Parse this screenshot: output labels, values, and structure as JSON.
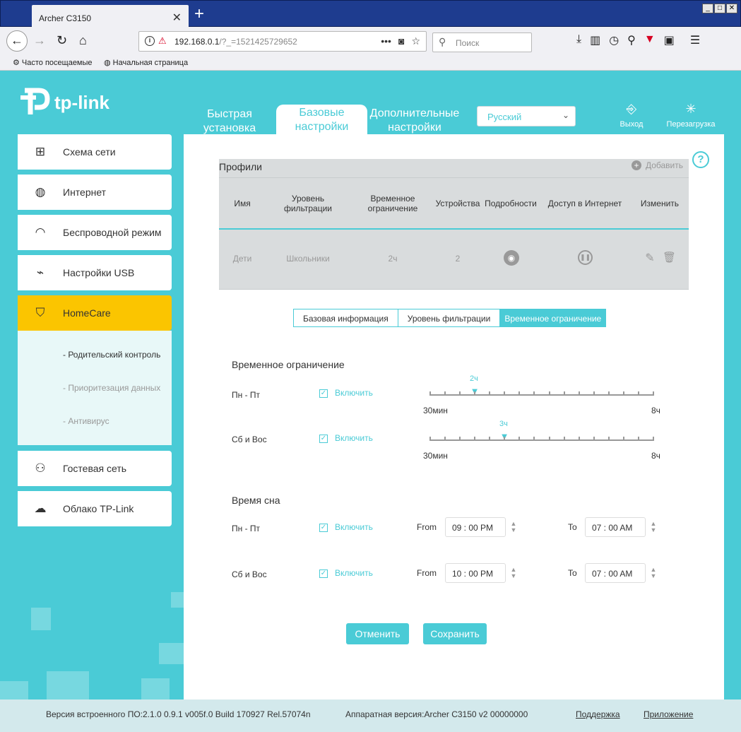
{
  "browser": {
    "tab_title": "Archer C3150",
    "url_host": "192.168.0.1",
    "url_rest": "/?_=1521425729652",
    "search_placeholder": "Поиск",
    "bookmarks": [
      "Часто посещаемые",
      "Начальная страница"
    ]
  },
  "brand": {
    "logo_text": "tp-link",
    "accent": "#4acbd6",
    "highlight": "#fbc500"
  },
  "topnav": {
    "quick": "Быстрая установка",
    "basic": "Базовые настройки",
    "advanced": "Дополнительные настройки",
    "language": "Русский",
    "logout": "Выход",
    "reboot": "Перезагрузка"
  },
  "sidebar": {
    "items": [
      {
        "label": "Схема сети",
        "icon": "network-map-icon"
      },
      {
        "label": "Интернет",
        "icon": "globe-icon"
      },
      {
        "label": "Беспроводной режим",
        "icon": "wifi-icon"
      },
      {
        "label": "Настройки USB",
        "icon": "usb-icon"
      },
      {
        "label": "HomeCare",
        "icon": "shield-icon"
      },
      {
        "label": "Гостевая сеть",
        "icon": "guests-icon"
      },
      {
        "label": "Облако TP-Link",
        "icon": "cloud-icon"
      }
    ],
    "sub_items": [
      "- Родительский контроль",
      "- Приоритезация данных",
      "- Антивирус"
    ]
  },
  "profiles": {
    "title": "Профили",
    "add_label": "Добавить",
    "headers": {
      "name": "Имя",
      "filter": "Уровень фильтрации",
      "time": "Временное ограничение",
      "devices": "Устройства",
      "details": "Подробности",
      "access": "Доступ в Интернет",
      "edit": "Изменить"
    },
    "row": {
      "name": "Дети",
      "filter": "Школьники",
      "time": "2ч",
      "devices": "2"
    }
  },
  "subtabs": [
    "Базовая информация",
    "Уровень фильтрации",
    "Временное ограничение"
  ],
  "time_limit": {
    "title": "Временное ограничение",
    "min_label": "30мин",
    "max_label": "8ч",
    "enable_label": "Включить",
    "weekdays": {
      "label": "Пн - Пт",
      "value_label": "2ч",
      "value_hours": 2
    },
    "weekend": {
      "label": "Сб и Вос",
      "value_label": "3ч",
      "value_hours": 3
    }
  },
  "sleep": {
    "title": "Время сна",
    "from_label": "From",
    "to_label": "To",
    "weekdays": {
      "label": "Пн - Пт",
      "from": "09 : 00  PM",
      "to": "07 : 00  AM"
    },
    "weekend": {
      "label": "Сб и Вос",
      "from": "10 : 00  PM",
      "to": "07 : 00  AM"
    }
  },
  "buttons": {
    "cancel": "Отменить",
    "save": "Сохранить"
  },
  "footer": {
    "firmware": "Версия встроенного ПО:2.1.0 0.9.1 v005f.0 Build 170927 Rel.57074n",
    "hardware": "Аппаратная версия:Archer C3150 v2 00000000",
    "support": "Поддержка",
    "app": "Приложение"
  }
}
